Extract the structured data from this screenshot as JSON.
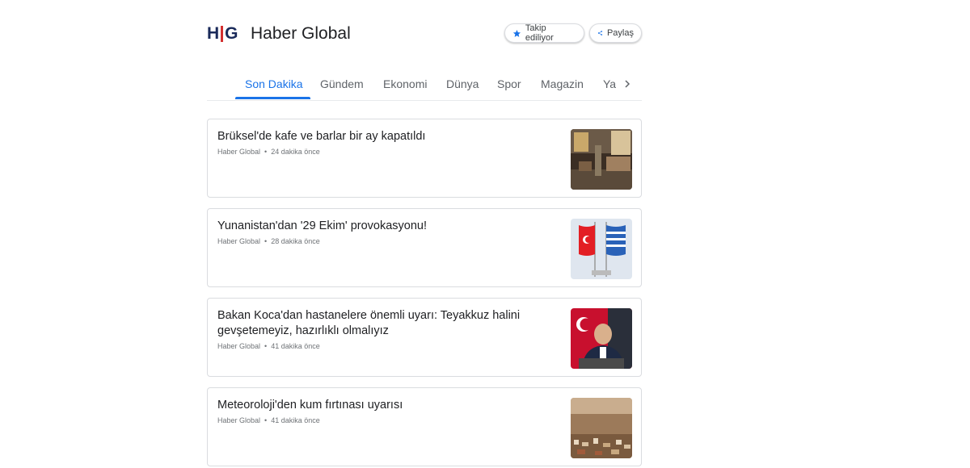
{
  "header": {
    "logo_text_left": "H",
    "logo_text_right": "G",
    "publisher_name": "Haber Global",
    "follow_label": "Takip ediliyor",
    "share_label": "Paylaş"
  },
  "tabs": [
    {
      "label": "Son Dakika",
      "active": true
    },
    {
      "label": "Gündem"
    },
    {
      "label": "Ekonomi"
    },
    {
      "label": "Dünya"
    },
    {
      "label": "Spor"
    },
    {
      "label": "Magazin"
    },
    {
      "label": "Yaşam"
    }
  ],
  "articles": [
    {
      "title": "Brüksel'de kafe ve barlar bir ay kapatıldı",
      "source": "Haber Global",
      "time": "24 dakika önce",
      "image": "cafe-street-photo"
    },
    {
      "title": "Yunanistan'dan '29 Ekim' provokasyonu!",
      "source": "Haber Global",
      "time": "28 dakika önce",
      "image": "turkish-greek-flags-photo"
    },
    {
      "title": "Bakan Koca'dan hastanelere önemli uyarı: Teyakkuz halini gevşetemeyiz, hazırlıklı olmalıyız",
      "source": "Haber Global",
      "time": "41 dakika önce",
      "image": "minister-speech-photo"
    },
    {
      "title": "Meteoroloji'den kum fırtınası uyarısı",
      "source": "Haber Global",
      "time": "41 dakika önce",
      "image": "sandstorm-city-photo"
    }
  ],
  "colors": {
    "accent": "#1a73e8",
    "logo_red": "#d32f2f",
    "logo_navy": "#1a2a5a"
  }
}
